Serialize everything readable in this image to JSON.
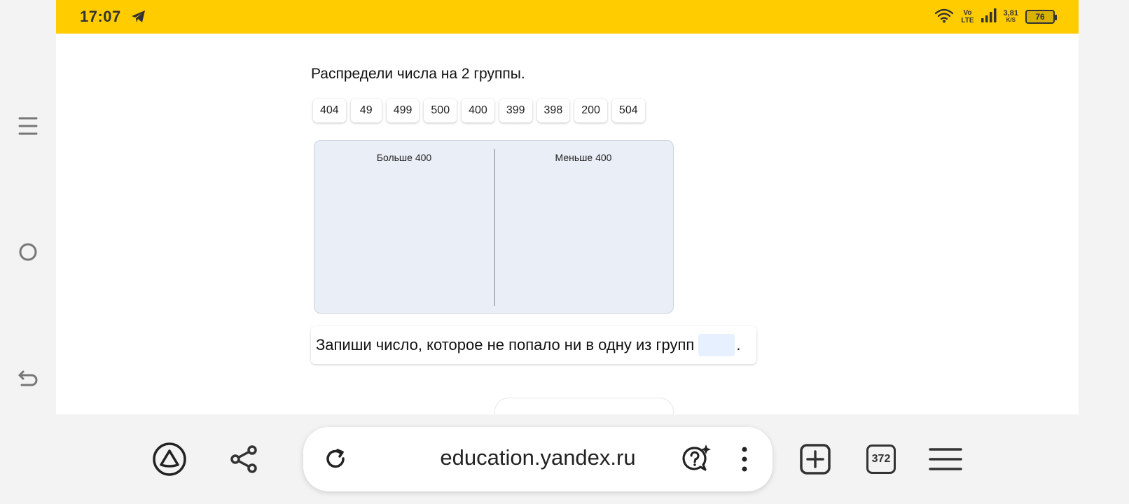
{
  "status": {
    "time": "17:07",
    "volte_line1": "Vo",
    "volte_line2": "LTE",
    "speed_value": "3,81",
    "speed_unit": "K/S",
    "battery": "76"
  },
  "task": {
    "title": "Распредели числа на 2 группы.",
    "numbers": [
      "404",
      "49",
      "499",
      "500",
      "400",
      "399",
      "398",
      "200",
      "504"
    ],
    "groups": [
      "Больше 400",
      "Меньше 400"
    ],
    "answer_prompt": "Запиши число, которое не попало ни в одну из групп",
    "answer_value": "",
    "answer_suffix": "."
  },
  "browser": {
    "url": "education.yandex.ru",
    "tab_count": "372"
  },
  "icons": {
    "alice": "alice-icon",
    "share": "share-icon",
    "reload": "reload-icon",
    "ask": "ai-question-icon",
    "more": "more-vertical-icon",
    "new_tab": "new-tab-icon",
    "tabs": "tabs-counter-icon",
    "menu": "hamburger-menu-icon"
  },
  "colors": {
    "status_bar": "#ffcc00",
    "sort_box": "#e9eef7",
    "answer_input": "#e6f0ff"
  }
}
